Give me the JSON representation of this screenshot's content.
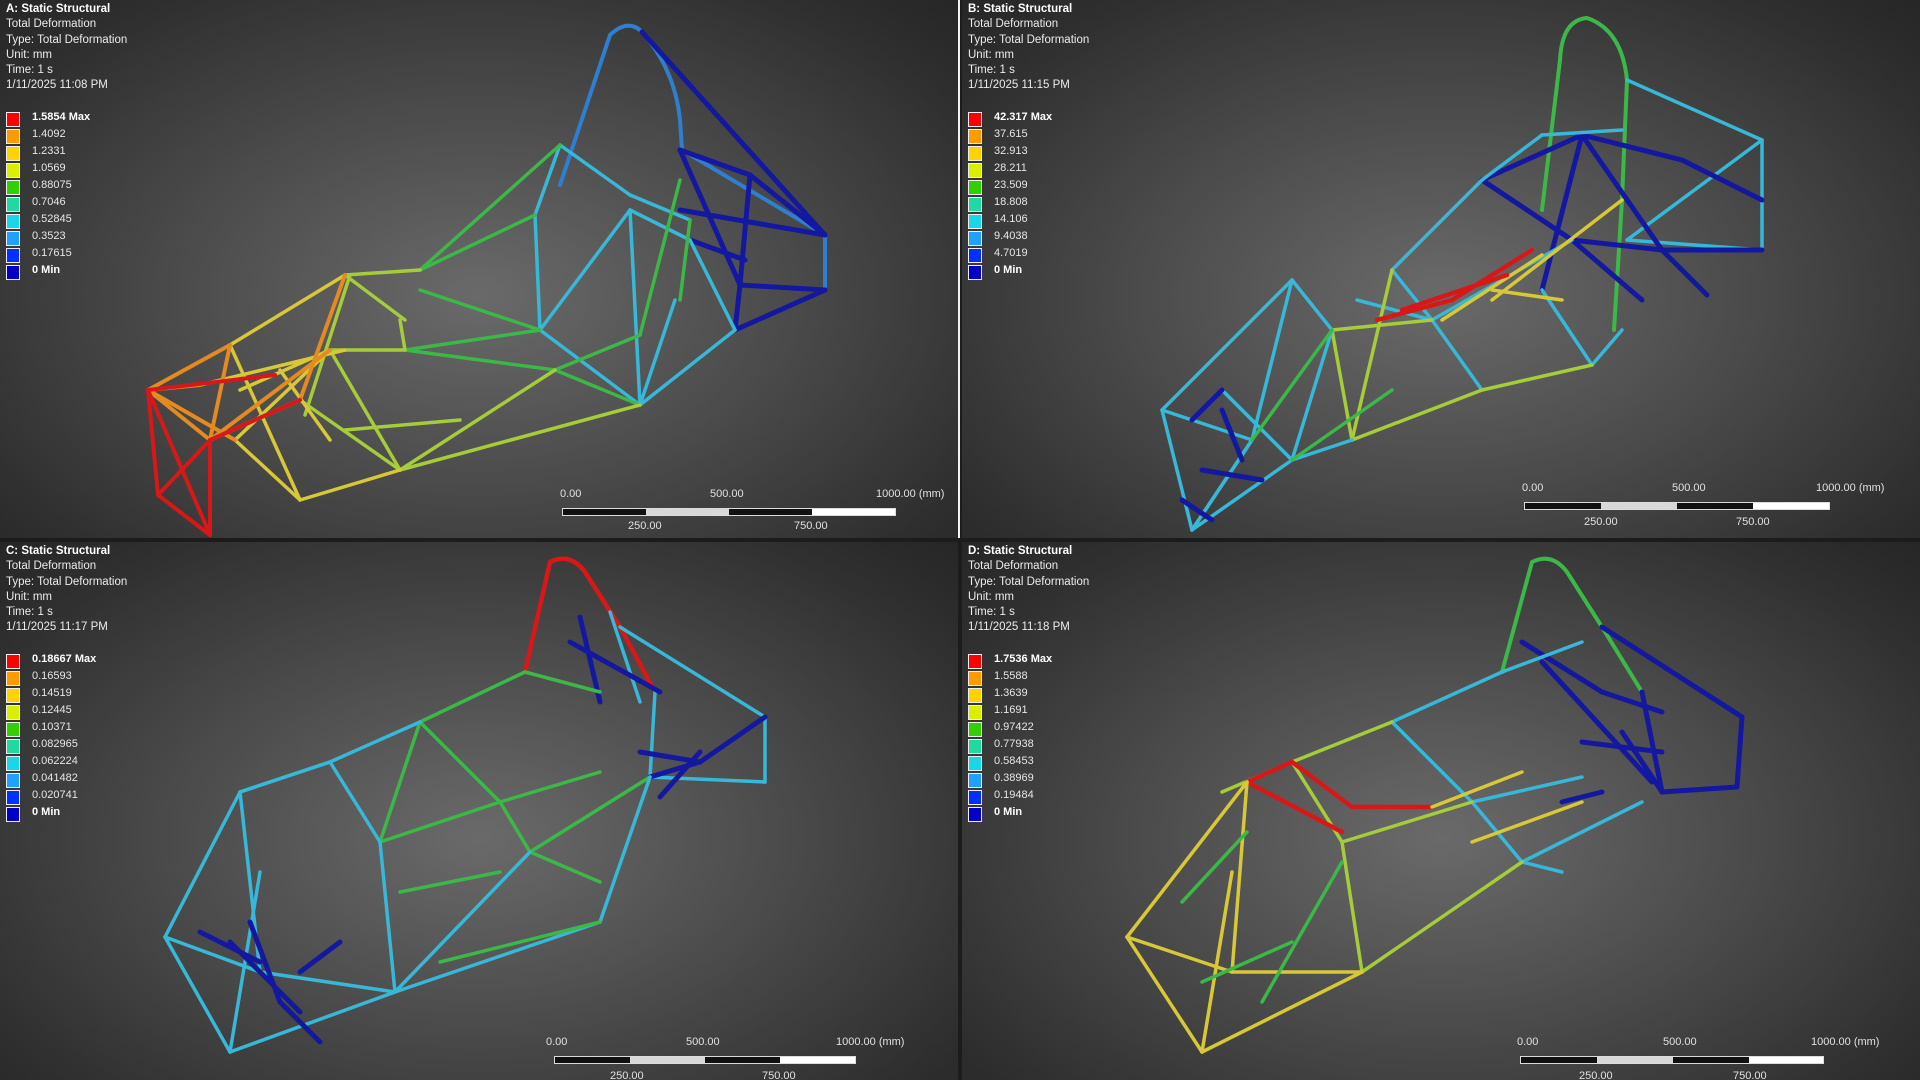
{
  "panels": [
    {
      "title": "A: Static Structural",
      "lines": [
        "Total Deformation",
        "Type: Total Deformation",
        "Unit: mm",
        "Time: 1 s",
        "1/11/2025 11:08 PM"
      ],
      "legend": [
        "1.5854 Max",
        "1.4092",
        "1.2331",
        "1.0569",
        "0.88075",
        "0.7046",
        "0.52845",
        "0.3523",
        "0.17615",
        "0 Min"
      ],
      "scale": {
        "t0": "0.00",
        "t1": "500.00",
        "t2": "1000.00 (mm)",
        "b1": "250.00",
        "b2": "750.00"
      }
    },
    {
      "title": "B: Static Structural",
      "lines": [
        "Total Deformation",
        "Type: Total Deformation",
        "Unit: mm",
        "Time: 1 s",
        "1/11/2025 11:15 PM"
      ],
      "legend": [
        "42.317 Max",
        "37.615",
        "32.913",
        "28.211",
        "23.509",
        "18.808",
        "14.106",
        "9.4038",
        "4.7019",
        "0 Min"
      ],
      "scale": {
        "t0": "0.00",
        "t1": "500.00",
        "t2": "1000.00 (mm)",
        "b1": "250.00",
        "b2": "750.00"
      }
    },
    {
      "title": "C: Static Structural",
      "lines": [
        "Total Deformation",
        "Type: Total Deformation",
        "Unit: mm",
        "Time: 1 s",
        "1/11/2025 11:17 PM"
      ],
      "legend": [
        "0.18667 Max",
        "0.16593",
        "0.14519",
        "0.12445",
        "0.10371",
        "0.082965",
        "0.062224",
        "0.041482",
        "0.020741",
        "0 Min"
      ],
      "scale": {
        "t0": "0.00",
        "t1": "500.00",
        "t2": "1000.00 (mm)",
        "b1": "250.00",
        "b2": "750.00"
      }
    },
    {
      "title": "D: Static Structural",
      "lines": [
        "Total Deformation",
        "Type: Total Deformation",
        "Unit: mm",
        "Time: 1 s",
        "1/11/2025 11:18 PM"
      ],
      "legend": [
        "1.7536 Max",
        "1.5588",
        "1.3639",
        "1.1691",
        "0.97422",
        "0.77938",
        "0.58453",
        "0.38969",
        "0.19484",
        "0 Min"
      ],
      "scale": {
        "t0": "0.00",
        "t1": "500.00",
        "t2": "1000.00 (mm)",
        "b1": "250.00",
        "b2": "750.00"
      }
    }
  ],
  "legend_colors": [
    "#ff0000",
    "#ff9a00",
    "#ffd200",
    "#d8f000",
    "#32d000",
    "#20d8a0",
    "#18d8e8",
    "#20a0ff",
    "#0030ff",
    "#0000c8"
  ],
  "colors": {
    "red": "#d81818",
    "orange": "#e38a20",
    "yellow": "#d8c838",
    "lime": "#a6cc3a",
    "green": "#3cb848",
    "teal": "#38c8b0",
    "cyan": "#38b8d8",
    "blue": "#2f7fd0",
    "navy": "#1418a0"
  }
}
